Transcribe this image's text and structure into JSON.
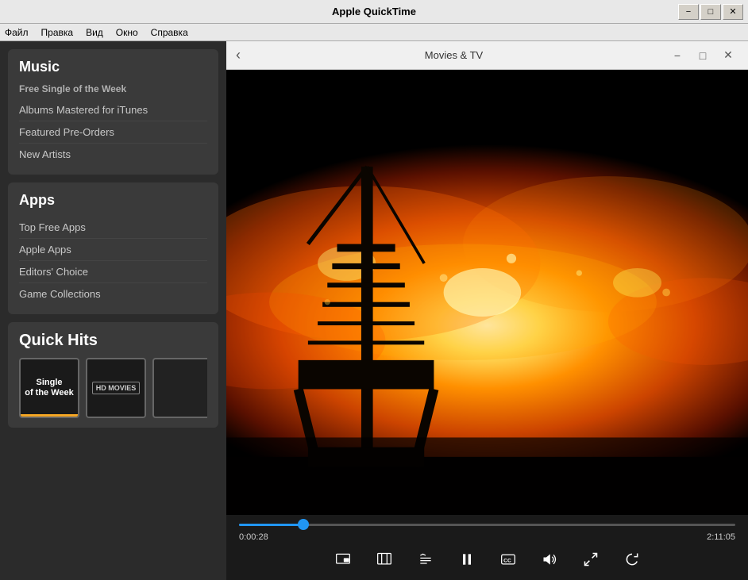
{
  "window": {
    "title": "Apple QuickTime",
    "minimize": "−",
    "restore": "□",
    "close": "✕"
  },
  "menu": {
    "items": [
      "Файл",
      "Правка",
      "Вид",
      "Окно",
      "Справка"
    ]
  },
  "sidebar": {
    "music_section": {
      "title": "Music",
      "subtitle": "Free Single of the Week",
      "links": [
        "Albums Mastered for iTunes",
        "Featured Pre-Orders",
        "New Artists"
      ]
    },
    "apps_section": {
      "title": "Apps",
      "links": [
        "Top Free Apps",
        "Apple Apps",
        "Editors' Choice",
        "Game Collections"
      ]
    },
    "quick_hits": {
      "title": "Quick Hits",
      "item1_line1": "Single",
      "item1_line2": "of the Week",
      "item2_label": "HD MOVIES"
    }
  },
  "video_player": {
    "titlebar_title": "Movies & TV",
    "current_time": "0:00:28",
    "total_time": "2:11:05",
    "progress_percent": 13,
    "controls": {
      "pip": "⊡",
      "chapters": "⊟",
      "captions": "CC",
      "volume": "🔊",
      "fullscreen": "⤢",
      "replay": "↺",
      "pause": "⏸"
    }
  }
}
